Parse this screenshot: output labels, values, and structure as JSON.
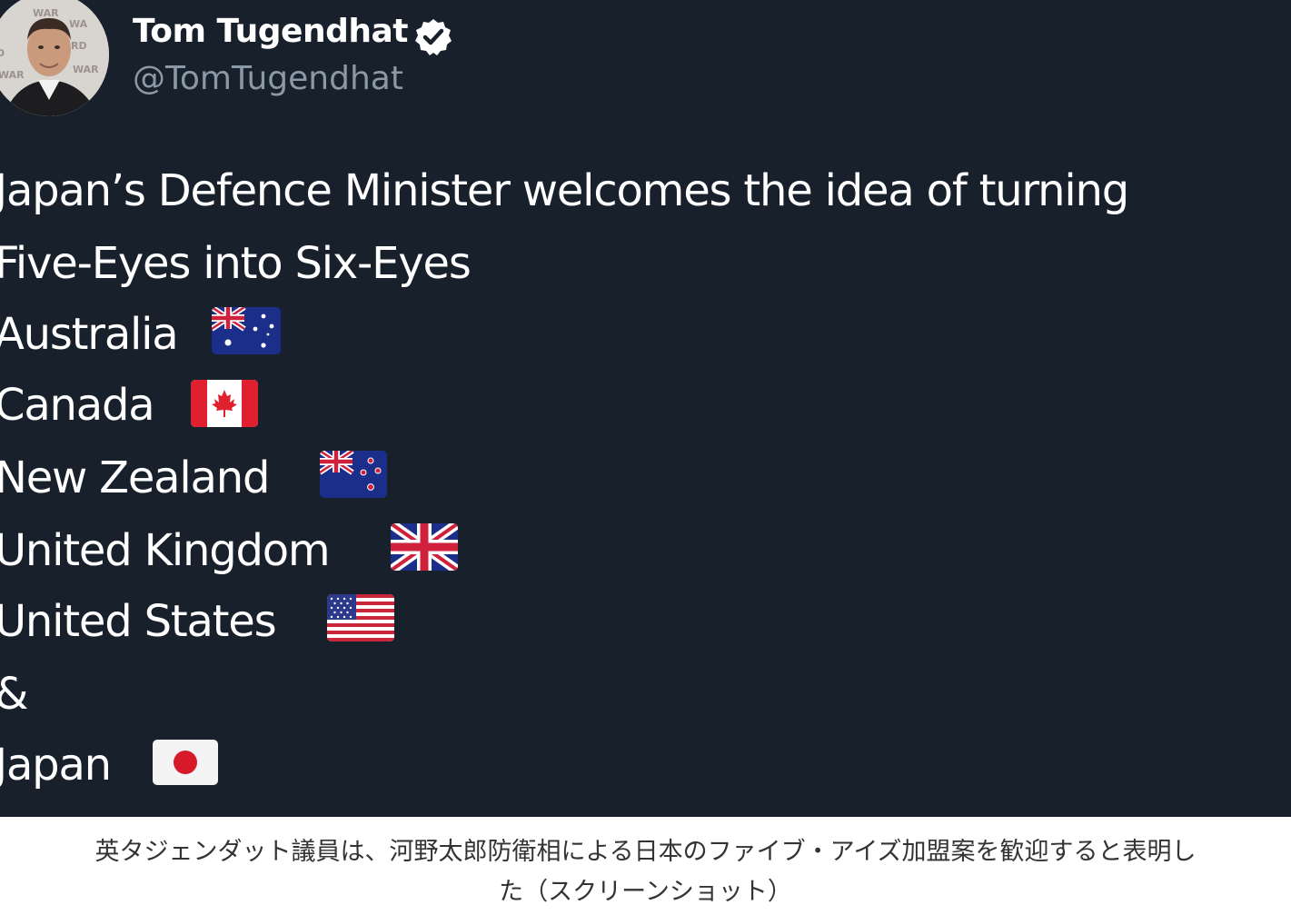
{
  "tweet": {
    "author_name": "Tom Tugendhat",
    "author_handle": "@TomTugendhat",
    "verified_icon": "verified-badge-icon",
    "avatar_backdrop_text": "WAR  RD▷  WAR",
    "lines": [
      "Japan’s Defence Minister welcomes the idea of turning",
      "Five-Eyes into Six-Eyes",
      "Australia",
      "Canada",
      "New Zealand",
      "United Kingdom",
      "United States",
      "&",
      "Japan"
    ],
    "flags": [
      {
        "country": "Australia",
        "icon": "australia-flag-icon"
      },
      {
        "country": "Canada",
        "icon": "canada-flag-icon"
      },
      {
        "country": "New Zealand",
        "icon": "new-zealand-flag-icon"
      },
      {
        "country": "United Kingdom",
        "icon": "united-kingdom-flag-icon"
      },
      {
        "country": "United States",
        "icon": "united-states-flag-icon"
      },
      {
        "country": "Japan",
        "icon": "japan-flag-icon"
      }
    ]
  },
  "caption": {
    "line1": "英タジェンダット議員は、河野太郎防衛相による日本のファイブ・アイズ加盟案を歓迎すると表明し",
    "line2": "た（スクリーンショット）"
  },
  "colors": {
    "tweet_background": "#17202b",
    "text_primary": "#ffffff",
    "text_secondary": "#8b98a5",
    "caption_text": "#333333",
    "page_background": "#ffffff"
  }
}
